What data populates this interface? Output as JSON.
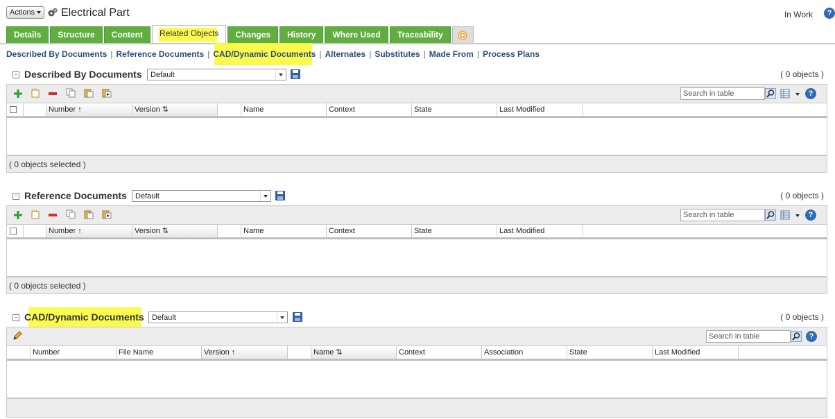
{
  "header": {
    "actions_label": "Actions",
    "title": "Electrical Part",
    "state": "In Work"
  },
  "tabs": [
    {
      "label": "Details"
    },
    {
      "label": "Structure"
    },
    {
      "label": "Content"
    },
    {
      "label": "Related Objects",
      "active": true
    },
    {
      "label": "Changes"
    },
    {
      "label": "History"
    },
    {
      "label": "Where Used"
    },
    {
      "label": "Traceability"
    }
  ],
  "sublinks": [
    "Described By Documents",
    "Reference Documents",
    "CAD/Dynamic Documents",
    "Alternates",
    "Substitutes",
    "Made From",
    "Process Plans"
  ],
  "colors": {
    "tab_green": "#5fae3f",
    "highlight": "#fafa2e",
    "link": "#2b4d7c"
  },
  "sections": [
    {
      "title": "Described By Documents",
      "view": "Default",
      "count": "( 0 objects )",
      "search_placeholder": "Search in table",
      "columns": [
        "Number",
        "Version",
        "Name",
        "Context",
        "State",
        "Last Modified"
      ],
      "footer": "( 0 objects selected )"
    },
    {
      "title": "Reference Documents",
      "view": "Default",
      "count": "( 0 objects )",
      "search_placeholder": "Search in table",
      "columns": [
        "Number",
        "Version",
        "Name",
        "Context",
        "State",
        "Last Modified"
      ],
      "footer": "( 0 objects selected )"
    },
    {
      "title": "CAD/Dynamic Documents",
      "view": "Default",
      "count": "( 0 objects )",
      "search_placeholder": "Search in table",
      "columns": [
        "Number",
        "File Name",
        "Version",
        "Name",
        "Context",
        "Association",
        "State",
        "Last Modified"
      ]
    }
  ],
  "icons": [
    "gear-part-icon",
    "add-icon",
    "new-icon",
    "remove-icon",
    "copy-icon",
    "paste-icon",
    "paste-select-icon",
    "search-icon",
    "column-config-icon",
    "help-icon",
    "edit-icon",
    "save-view-icon"
  ]
}
